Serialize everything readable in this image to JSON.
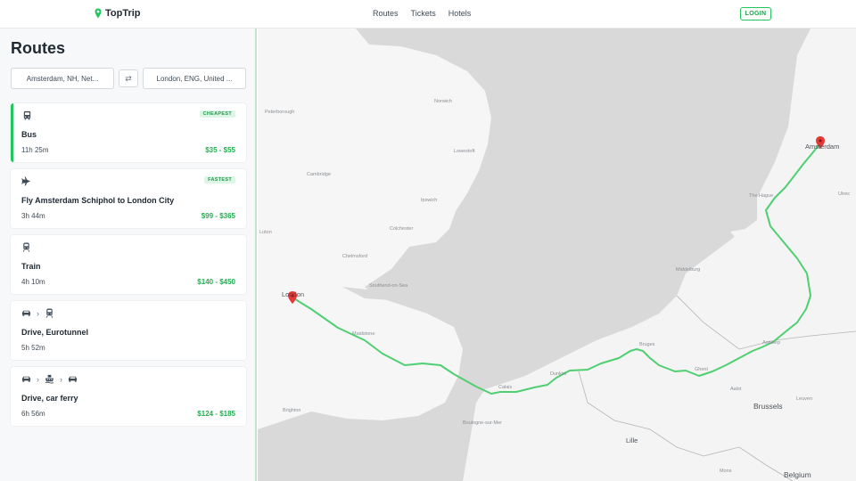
{
  "brand": {
    "name": "TopTrip",
    "accent": "#22c55e"
  },
  "nav": {
    "items": [
      "Routes",
      "Tickets",
      "Hotels"
    ],
    "login": "LOGIN"
  },
  "sidebar": {
    "title": "Routes",
    "from_value": "Amsterdam, NH, Net...",
    "to_value": "London, ENG, United ...",
    "swap_icon": "⇄"
  },
  "routes": [
    {
      "icons": [
        "bus-icon"
      ],
      "badge": "CHEAPEST",
      "name": "Bus",
      "duration": "11h 25m",
      "price": "$35 - $55",
      "selected": true
    },
    {
      "icons": [
        "plane-icon"
      ],
      "badge": "FASTEST",
      "name": "Fly Amsterdam Schiphol to London City",
      "duration": "3h 44m",
      "price": "$99 - $365"
    },
    {
      "icons": [
        "train-icon"
      ],
      "name": "Train",
      "duration": "4h 10m",
      "price": "$140 - $450"
    },
    {
      "icons": [
        "car-icon",
        "train-icon"
      ],
      "name": "Drive, Eurotunnel",
      "duration": "5h 52m",
      "price": ""
    },
    {
      "icons": [
        "car-icon",
        "ferry-icon",
        "car-icon"
      ],
      "name": "Drive, car ferry",
      "duration": "6h 56m",
      "price": "$124 - $185"
    }
  ],
  "map": {
    "route_color": "#4fcf72",
    "marker_color": "#e53935",
    "places": {
      "amsterdam": "Amsterdam",
      "london": "London",
      "brussels": "Brussels",
      "belgium": "Belgium",
      "lille": "Lille",
      "bruges": "Bruges",
      "antwerp": "Antwerp",
      "ghent": "Ghent",
      "the_hague": "The Hague",
      "middelburg": "Middelburg",
      "dunkirk": "Dunkirk",
      "calais": "Calais",
      "norwich": "Norwich",
      "ipswich": "Ipswich",
      "cambridge": "Cambridge",
      "colchester": "Colchester",
      "chelmsford": "Chelmsford",
      "peterborough": "Peterborough",
      "brighton": "Brighton",
      "southend": "Southend-on-Sea",
      "lowestoft": "Lowestoft",
      "utrecht": "Utrec",
      "leuven": "Leuven",
      "mons": "Mons",
      "boulogne": "Boulogne-sur-Mer",
      "luton": "Luton",
      "maidstone": "Maidstone",
      "aalst": "Aalst"
    }
  }
}
